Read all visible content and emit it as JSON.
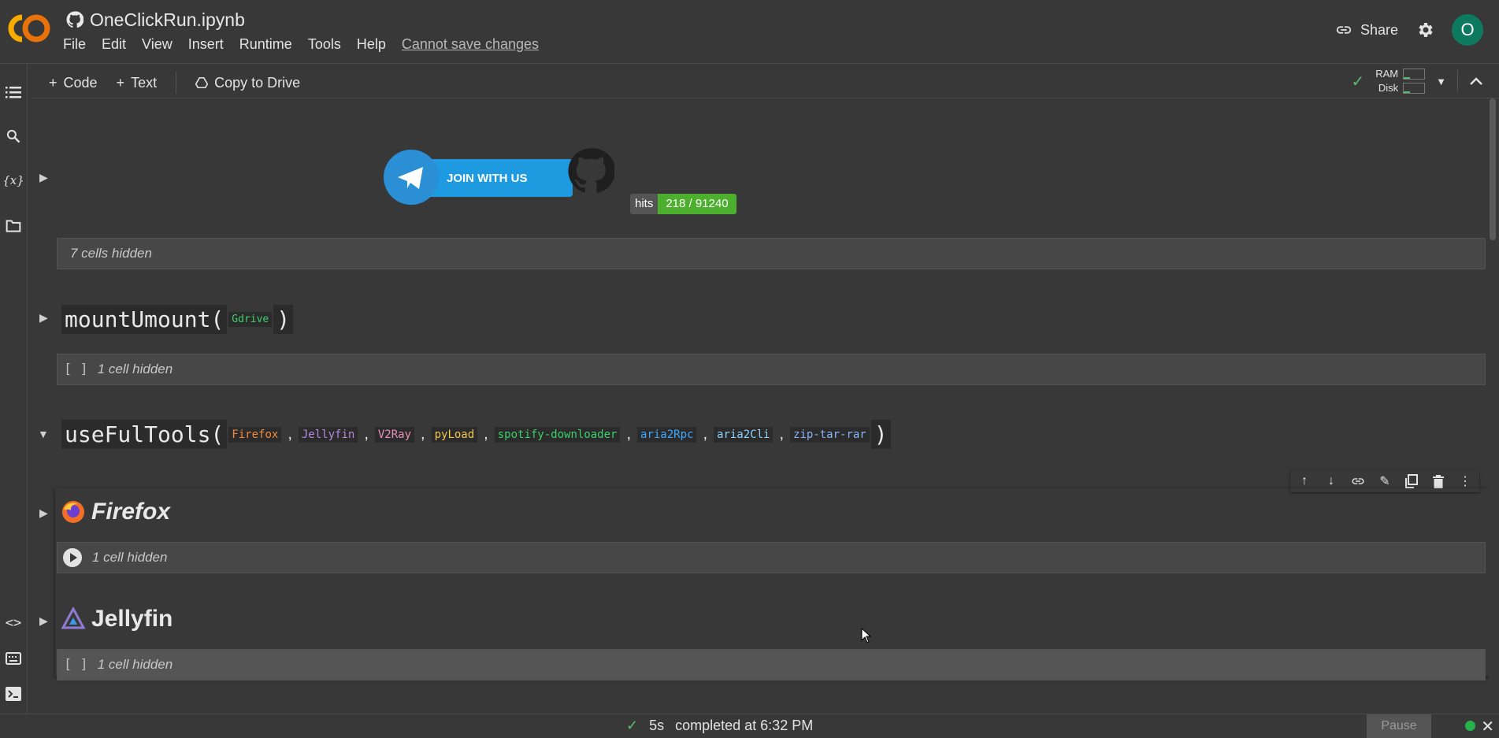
{
  "header": {
    "notebook_title": "OneClickRun.ipynb",
    "menu": [
      "File",
      "Edit",
      "View",
      "Insert",
      "Runtime",
      "Tools",
      "Help"
    ],
    "cannot_save": "Cannot save changes",
    "share_label": "Share",
    "avatar_letter": "O"
  },
  "toolbar": {
    "add_code": "Code",
    "add_text": "Text",
    "copy_to_drive": "Copy to Drive",
    "ram_label": "RAM",
    "disk_label": "Disk"
  },
  "content": {
    "telegram_button": "JOIN WITH US",
    "hits_label": "hits",
    "hits_value": "218 / 91240",
    "hidden_7": "7 cells hidden",
    "mount": {
      "name": "mountUmount(",
      "arg": "Gdrive",
      "close": ")"
    },
    "hidden_mount": "1 cell hidden",
    "tools": {
      "name": "useFulTools(",
      "close": ")",
      "args": [
        {
          "label": "Firefox",
          "color": "#f28b3c"
        },
        {
          "label": "Jellyfin",
          "color": "#b48ade"
        },
        {
          "label": "V2Ray",
          "color": "#e891b5"
        },
        {
          "label": "pyLoad",
          "color": "#f2c94c"
        },
        {
          "label": "spotify-downloader",
          "color": "#3ccf6a"
        },
        {
          "label": "aria2Rpc",
          "color": "#3ea8ff"
        },
        {
          "label": "aria2Cli",
          "color": "#8fd3ff"
        },
        {
          "label": "zip-tar-rar",
          "color": "#8ab4f8"
        }
      ],
      "separator": ","
    },
    "firefox_title": "Firefox",
    "hidden_firefox": "1 cell hidden",
    "jellyfin_title": "Jellyfin",
    "hidden_jellyfin": "1 cell hidden",
    "bracket": "[ ]"
  },
  "status": {
    "elapsed": "5s",
    "completed": "completed at 6:32 PM",
    "pause": "Pause"
  },
  "colors": {
    "background": "#383838",
    "hidden_bar": "#474747",
    "accent_orange": "#f9ab00",
    "status_green": "#25b34a"
  }
}
